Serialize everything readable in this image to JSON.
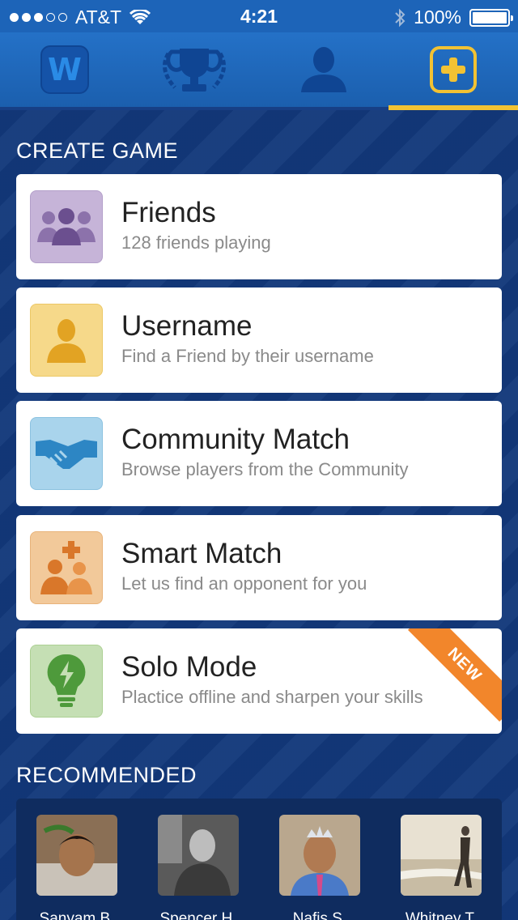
{
  "status_bar": {
    "carrier": "AT&T",
    "time": "4:21",
    "battery": "100%",
    "signal_bars": 3
  },
  "tabs": [
    {
      "name": "words",
      "label": "W",
      "active": false
    },
    {
      "name": "leaderboard",
      "active": false
    },
    {
      "name": "profile",
      "active": false
    },
    {
      "name": "create-game",
      "active": true
    }
  ],
  "create_game": {
    "heading": "CREATE GAME",
    "options": [
      {
        "title": "Friends",
        "subtitle": "128 friends playing",
        "icon": "friends-group-icon",
        "color": "#c6b4d8"
      },
      {
        "title": "Username",
        "subtitle": "Find a Friend by their username",
        "icon": "user-silhouette-icon",
        "color": "#f6d98a"
      },
      {
        "title": "Community Match",
        "subtitle": "Browse players from the Community",
        "icon": "handshake-icon",
        "color": "#a9d4ec"
      },
      {
        "title": "Smart Match",
        "subtitle": "Let us find an opponent for you",
        "icon": "smart-match-icon",
        "color": "#f2c99a"
      },
      {
        "title": "Solo Mode",
        "subtitle": "Plactice offline and sharpen your skills",
        "icon": "lightbulb-icon",
        "color": "#c5dfb4",
        "badge": "NEW"
      }
    ]
  },
  "recommended": {
    "heading": "RECOMMENDED",
    "players": [
      {
        "name": "Sanyam B."
      },
      {
        "name": "Spencer H."
      },
      {
        "name": "Nafis S."
      },
      {
        "name": "Whitney T."
      }
    ]
  },
  "colors": {
    "accent": "#f2c233",
    "tab_bar": "#2471c7",
    "background": "#12387a",
    "badge": "#f2862b"
  }
}
